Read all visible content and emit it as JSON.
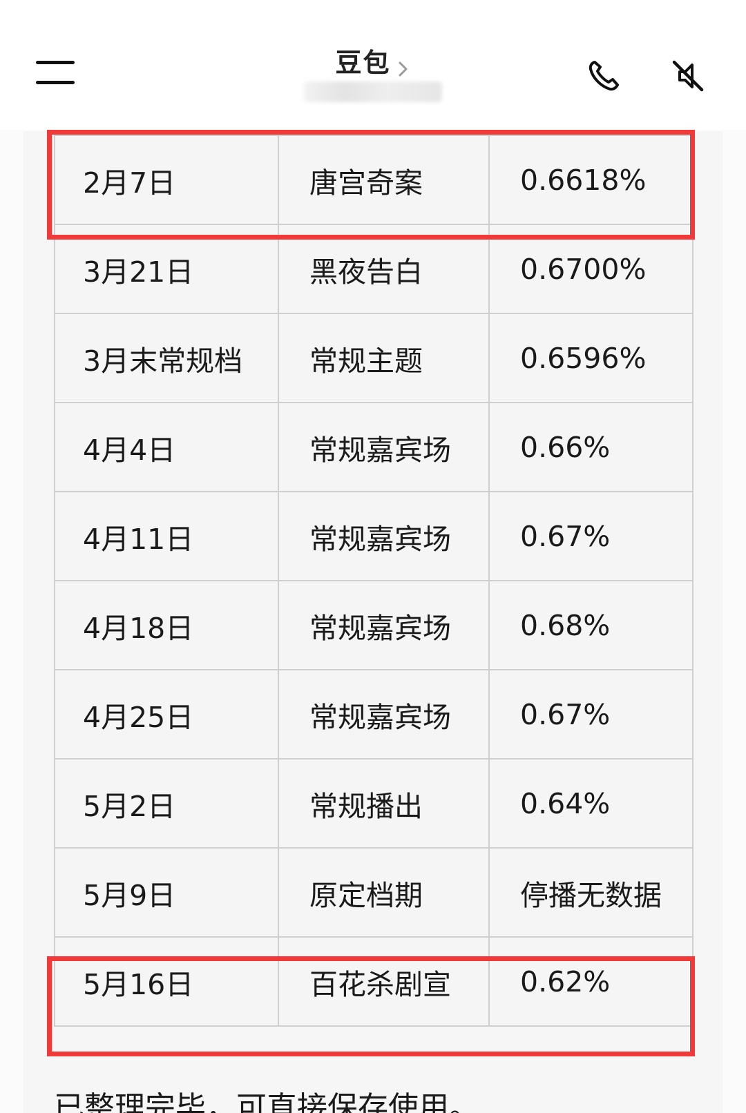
{
  "header": {
    "title": "豆包",
    "icons": {
      "menu": "menu-icon",
      "chevron": "chevron-right-icon",
      "phone": "phone-icon",
      "mute": "speaker-muted-icon"
    }
  },
  "table": {
    "rows": [
      {
        "date": "2月7日",
        "topic": "唐宫奇案",
        "rate": "0.6618%"
      },
      {
        "date": "3月21日",
        "topic": "黑夜告白",
        "rate": "0.6700%"
      },
      {
        "date": "3月末常规档",
        "topic": "常规主题",
        "rate": "0.6596%"
      },
      {
        "date": "4月4日",
        "topic": "常规嘉宾场",
        "rate": "0.66%"
      },
      {
        "date": "4月11日",
        "topic": "常规嘉宾场",
        "rate": "0.67%"
      },
      {
        "date": "4月18日",
        "topic": "常规嘉宾场",
        "rate": "0.68%"
      },
      {
        "date": "4月25日",
        "topic": "常规嘉宾场",
        "rate": "0.67%"
      },
      {
        "date": "5月2日",
        "topic": "常规播出",
        "rate": "0.64%"
      },
      {
        "date": "5月9日",
        "topic": "原定档期",
        "rate": "停播无数据"
      },
      {
        "date": "5月16日",
        "topic": "百花杀剧宣",
        "rate": "0.62%"
      }
    ]
  },
  "message": {
    "footer": "已整理完毕，可直接保存使用。"
  },
  "colors": {
    "highlight": "#f03a3a",
    "border": "#cfcfcf",
    "text": "#1a1a1a"
  }
}
